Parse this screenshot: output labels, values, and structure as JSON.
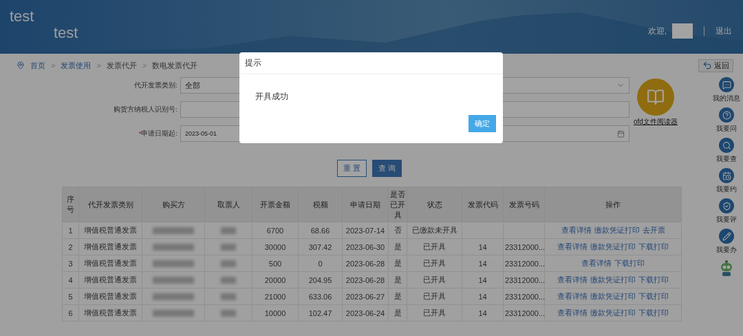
{
  "header": {
    "titles": [
      "test",
      "test"
    ],
    "welcome": "欢迎,",
    "logout": "退出"
  },
  "breadcrumb": [
    {
      "kind": "link",
      "text": "首页"
    },
    {
      "kind": "separator",
      "text": ">"
    },
    {
      "kind": "link",
      "text": "发票使用"
    },
    {
      "kind": "separator",
      "text": ">"
    },
    {
      "kind": "text",
      "text": "发票代开"
    },
    {
      "kind": "separator",
      "text": ">"
    },
    {
      "kind": "text",
      "text": "数电发票代开"
    }
  ],
  "back_button": "返回",
  "form": [
    {
      "kind": "select",
      "label": "代开发票类别:",
      "value": "全部"
    },
    {
      "kind": "text",
      "label": "购货方纳税人识别号:"
    },
    {
      "kind": "date",
      "label": "申请日期起:",
      "required_mark": "*",
      "value": "2023-05-01"
    }
  ],
  "ofd_reader": "ofd文件阅读器",
  "buttons": [
    "重 置",
    "查 询"
  ],
  "table": {
    "columns": [
      {
        "label": "序号",
        "kind": "text"
      },
      {
        "label": "代开发票类别",
        "kind": "text"
      },
      {
        "label": "购买方",
        "kind": "redacted"
      },
      {
        "label": "取票人",
        "kind": "redacted"
      },
      {
        "label": "开票金额",
        "kind": "text"
      },
      {
        "label": "税额",
        "kind": "text"
      },
      {
        "label": "申请日期",
        "kind": "text"
      },
      {
        "label": "是否已开具",
        "kind": "text"
      },
      {
        "label": "状态",
        "kind": "text"
      },
      {
        "label": "发票代码",
        "kind": "text"
      },
      {
        "label": "发票号码",
        "kind": "text"
      },
      {
        "label": "操作",
        "kind": "actions"
      }
    ],
    "rows": [
      {
        "cells": [
          "1",
          "增值税普通发票",
          "",
          "",
          "6700",
          "68.66",
          "2023-07-14",
          "否",
          "已缴款未开具",
          "",
          ""
        ],
        "actions": [
          "查看详情",
          "缴款凭证打印",
          "去开票"
        ]
      },
      {
        "cells": [
          "2",
          "增值税普通发票",
          "",
          "",
          "30000",
          "307.42",
          "2023-06-30",
          "是",
          "已开具",
          "14",
          "23312000..."
        ],
        "actions": [
          "查看详情",
          "缴款凭证打印",
          "下载打印"
        ]
      },
      {
        "cells": [
          "3",
          "增值税普通发票",
          "",
          "",
          "500",
          "0",
          "2023-06-28",
          "是",
          "已开具",
          "14",
          "23312000..."
        ],
        "actions": [
          "查看详情",
          "下载打印"
        ]
      },
      {
        "cells": [
          "4",
          "增值税普通发票",
          "",
          "",
          "20000",
          "204.95",
          "2023-06-28",
          "是",
          "已开具",
          "14",
          "23312000..."
        ],
        "actions": [
          "查看详情",
          "缴款凭证打印",
          "下载打印"
        ]
      },
      {
        "cells": [
          "5",
          "增值税普通发票",
          "",
          "",
          "21000",
          "633.06",
          "2023-06-27",
          "是",
          "已开具",
          "14",
          "23312000..."
        ],
        "actions": [
          "查看详情",
          "缴款凭证打印",
          "下载打印"
        ]
      },
      {
        "cells": [
          "6",
          "增值税普通发票",
          "",
          "",
          "10000",
          "102.47",
          "2023-06-24",
          "是",
          "已开具",
          "14",
          "23312000..."
        ],
        "actions": [
          "查看详情",
          "缴款凭证打印",
          "下载打印"
        ]
      }
    ]
  },
  "sidebar": [
    {
      "kind": "message",
      "label": "我的消息"
    },
    {
      "kind": "question",
      "label": "我要问"
    },
    {
      "kind": "search",
      "label": "我要查"
    },
    {
      "kind": "calendar",
      "label": "我要约"
    },
    {
      "kind": "rate",
      "label": "我要评"
    },
    {
      "kind": "edit",
      "label": "我要办"
    },
    {
      "kind": "robot"
    }
  ],
  "dialog": {
    "title": "提示",
    "message": "开具成功",
    "button": "确定"
  }
}
